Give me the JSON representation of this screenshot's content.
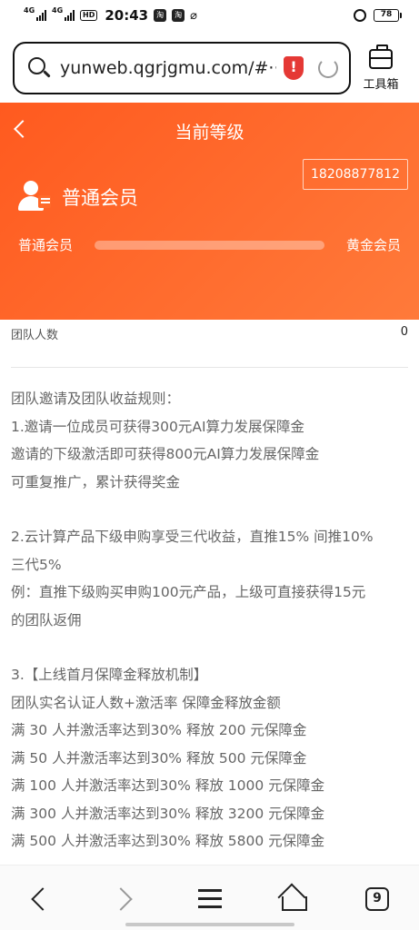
{
  "status_bar": {
    "net1": "4G",
    "net2": "4G",
    "hd": "HD",
    "time": "20:43",
    "app1": "淘",
    "app2": "淘",
    "battery_level": "78"
  },
  "browser": {
    "url": "yunweb.qgrjgmu.com/#···",
    "security_badge": "!",
    "toolbox_label": "工具箱"
  },
  "header": {
    "title": "当前等级",
    "phone": "18208877812",
    "member_name": "普通会员",
    "current_level": "普通会员",
    "next_level": "黄金会员",
    "progress_fraction": 0
  },
  "team": {
    "label": "团队人数",
    "value": "0"
  },
  "rules": [
    "团队邀请及团队收益规则：",
    "1.邀请一位成员可获得300元AI算力发展保障金",
    "邀请的下级激活即可获得800元AI算力发展保障金",
    "可重复推广，累计获得奖金",
    "",
    "2.云计算产品下级申购享受三代收益，直推15% 间推10%",
    "三代5%",
    "例：直推下级购买申购100元产品，上级可直接获得15元",
    "的团队返佣",
    "",
    "3.【上线首月保障金释放机制】",
    "团队实名认证人数+激活率 保障金释放金额",
    "满 30 人并激活率达到30% 释放 200 元保障金",
    "满 50 人并激活率达到30% 释放 500 元保障金",
    "满 100 人并激活率达到30% 释放 1000 元保障金",
    "满 300 人并激活率达到30% 释放 3200 元保障金",
    "满 500 人并激活率达到30% 释放 5800 元保障金"
  ],
  "nav": {
    "tab_count": "9"
  },
  "colors": {
    "header_orange": "#ff5a1f",
    "shield_red": "#e53935",
    "battery_green": "#38c54b"
  }
}
